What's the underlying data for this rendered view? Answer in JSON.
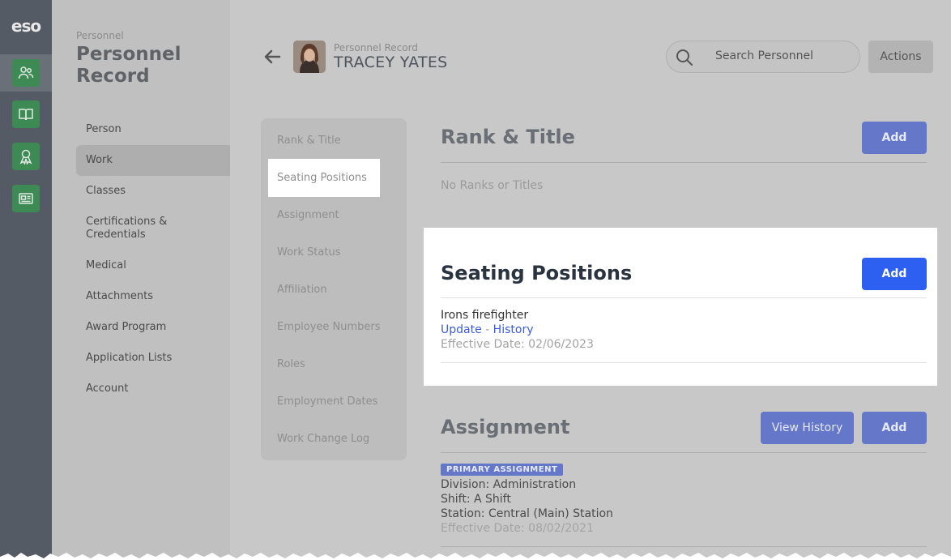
{
  "rail": {
    "logo": "eso",
    "icons": [
      "people-icon",
      "book-icon",
      "award-icon",
      "news-icon"
    ]
  },
  "sidenav": {
    "eyebrow": "Personnel",
    "title": "Personnel Record",
    "items": [
      {
        "label": "Person",
        "active": false
      },
      {
        "label": "Work",
        "active": true
      },
      {
        "label": "Classes",
        "active": false
      },
      {
        "label": "Certifications & Credentials",
        "active": false
      },
      {
        "label": "Medical",
        "active": false
      },
      {
        "label": "Attachments",
        "active": false
      },
      {
        "label": "Award Program",
        "active": false
      },
      {
        "label": "Application Lists",
        "active": false
      },
      {
        "label": "Account",
        "active": false
      }
    ]
  },
  "header": {
    "eyebrow": "Personnel Record",
    "name": "TRACEY YATES",
    "search_placeholder": "Search Personnel",
    "actions_label": "Actions"
  },
  "subnav": {
    "items": [
      "Rank & Title",
      "Seating Positions",
      "Assignment",
      "Work Status",
      "Affiliation",
      "Employee Numbers",
      "Roles",
      "Employment Dates",
      "Work Change Log"
    ],
    "selected": "Seating Positions"
  },
  "rank": {
    "title": "Rank & Title",
    "add_label": "Add",
    "empty_text": "No Ranks or Titles"
  },
  "seating": {
    "title": "Seating Positions",
    "add_label": "Add",
    "position": "Irons firefighter",
    "update_label": "Update",
    "separator": "-",
    "history_label": "History",
    "effective": "Effective Date: 02/06/2023"
  },
  "assignment": {
    "title": "Assignment",
    "view_history_label": "View History",
    "add_label": "Add",
    "badge": "PRIMARY ASSIGNMENT",
    "division": "Division: Administration",
    "shift": "Shift: A Shift",
    "station": "Station: Central (Main) Station",
    "effective": "Effective Date: 08/02/2021"
  },
  "colors": {
    "rail": "#545b64",
    "green": "#3e8a55",
    "primary": "#2d5ff0",
    "link": "#3b5bdb"
  }
}
